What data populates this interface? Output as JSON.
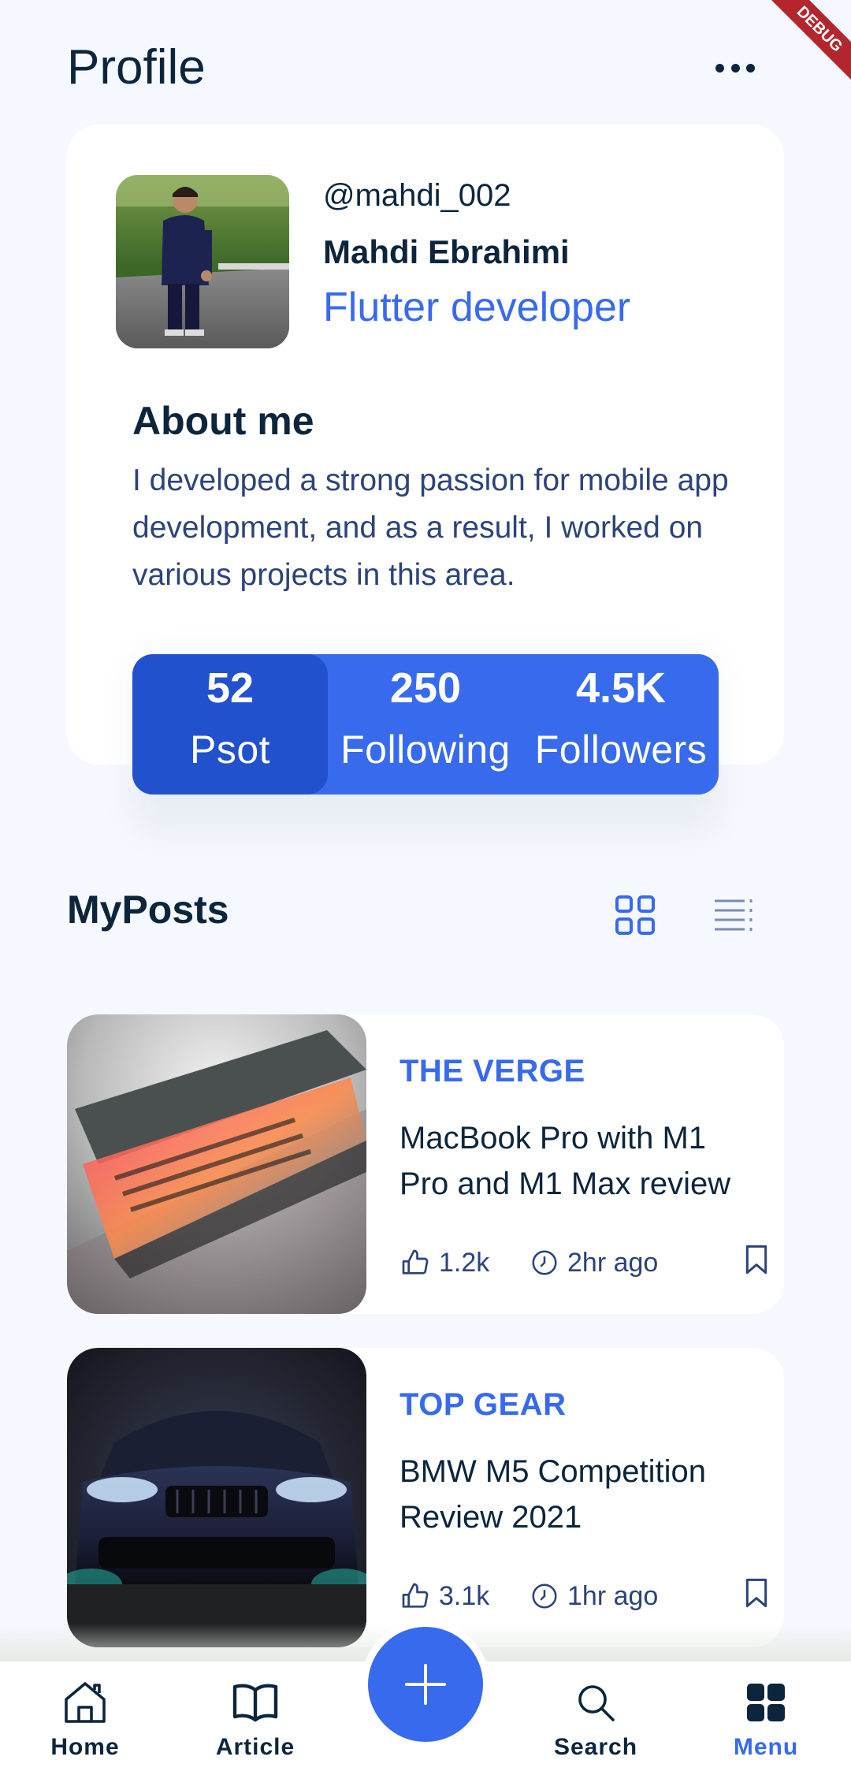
{
  "debug_banner": "DEBUG",
  "header": {
    "title": "Profile"
  },
  "profile": {
    "username": "@mahdi_002",
    "name": "Mahdi Ebrahimi",
    "role": "Flutter developer",
    "about_title": "About me",
    "about_text": " I developed a strong passion for mobile app development, and as a result, I worked on various projects in this area."
  },
  "stats": [
    {
      "value": "52",
      "label": "Psot"
    },
    {
      "value": "250",
      "label": "Following"
    },
    {
      "value": "4.5K",
      "label": "Followers"
    }
  ],
  "posts_section": {
    "title": "MyPosts"
  },
  "posts": [
    {
      "source": "THE VERGE",
      "title": "MacBook Pro with M1 Pro and M1 Max review",
      "likes": "1.2k",
      "time": "2hr ago"
    },
    {
      "source": "TOP GEAR",
      "title": "BMW M5 Competition Review 2021",
      "likes": "3.1k",
      "time": "1hr ago"
    }
  ],
  "nav": {
    "items": [
      {
        "label": "Home"
      },
      {
        "label": "Article"
      },
      {
        "label": "Search"
      },
      {
        "label": "Menu"
      }
    ],
    "active": "Menu"
  },
  "colors": {
    "accent": "#376aed",
    "accent_dark": "#2151cd",
    "text_dark": "#0d253c",
    "background": "#f5f8fe"
  }
}
